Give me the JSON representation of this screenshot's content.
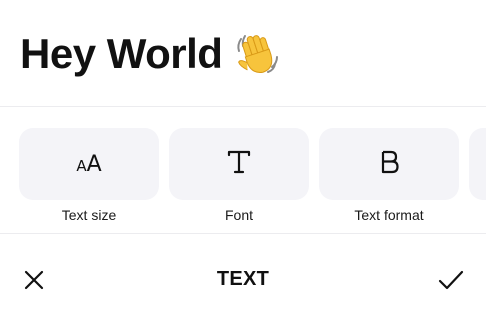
{
  "preview": {
    "text": "Hey World",
    "emoji_icon": "waving-hand-icon"
  },
  "options": [
    {
      "label": "Text size",
      "icon": "text-size-icon"
    },
    {
      "label": "Font",
      "icon": "font-icon"
    },
    {
      "label": "Text format",
      "icon": "bold-icon"
    }
  ],
  "toolbar": {
    "title": "TEXT",
    "close_icon": "close-icon",
    "confirm_icon": "checkmark-icon"
  },
  "colors": {
    "tile_background": "#f4f4f8",
    "text": "#111111",
    "divider": "#ececef"
  }
}
